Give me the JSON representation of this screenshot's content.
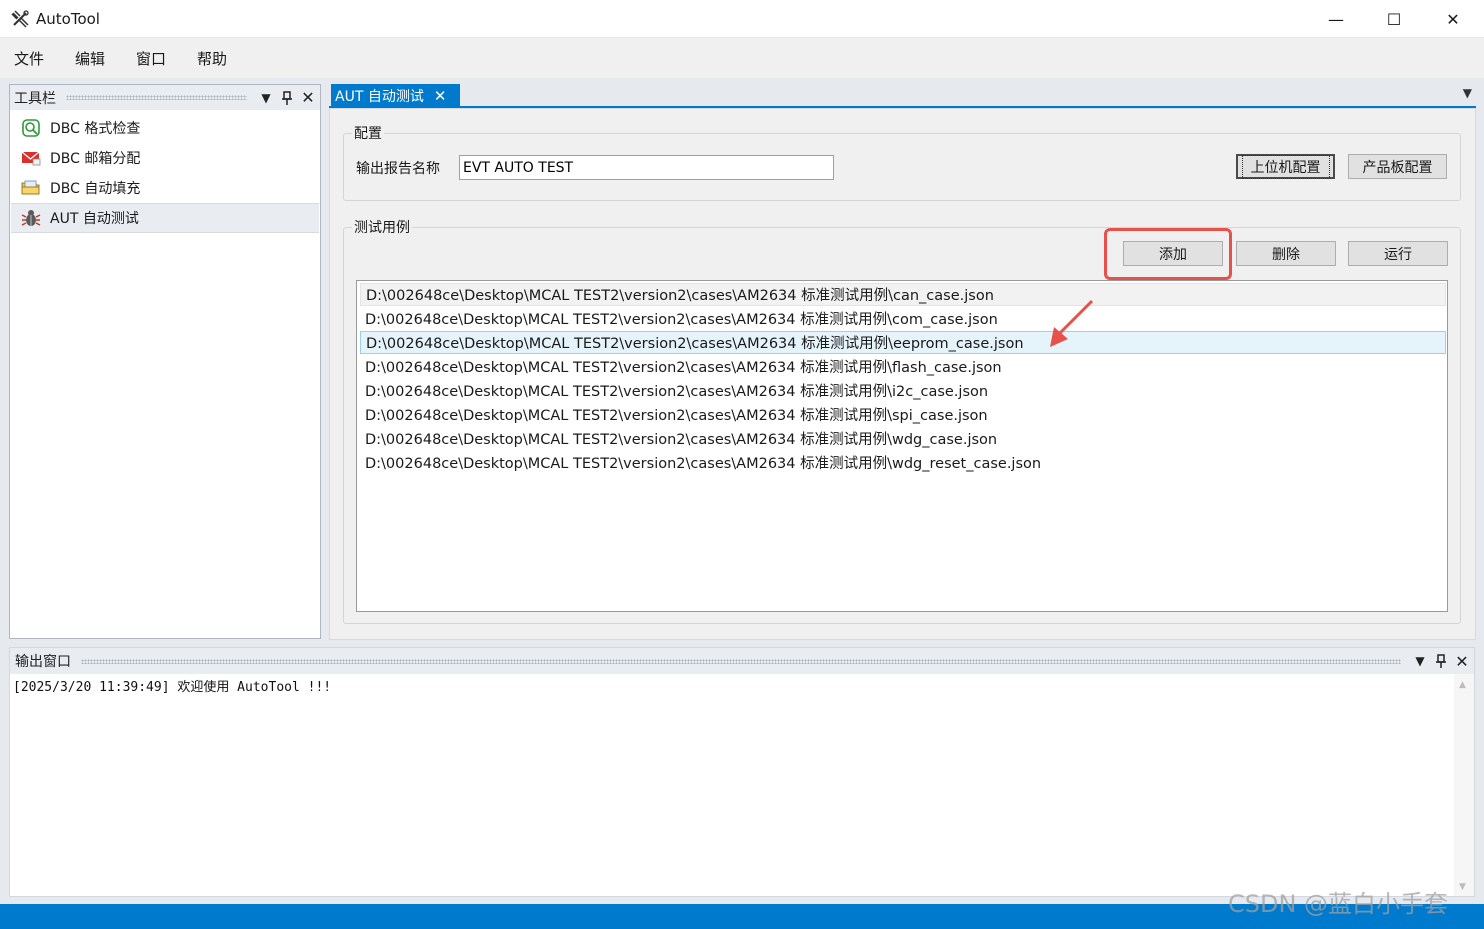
{
  "window": {
    "title": "AutoTool",
    "minimize_glyph": "—",
    "maximize_glyph": "☐",
    "close_glyph": "✕"
  },
  "menu": [
    "文件",
    "编辑",
    "窗口",
    "帮助"
  ],
  "toolbar_panel": {
    "title": "工具栏",
    "items": [
      {
        "label": "DBC 格式检查",
        "icon": "dbc-check-icon",
        "selected": false
      },
      {
        "label": "DBC 邮箱分配",
        "icon": "dbc-mailbox-icon",
        "selected": false
      },
      {
        "label": "DBC 自动填充",
        "icon": "dbc-autofill-icon",
        "selected": false
      },
      {
        "label": "AUT 自动测试",
        "icon": "bug-icon",
        "selected": true
      }
    ]
  },
  "document": {
    "tab_label": "AUT 自动测试",
    "config": {
      "group_label": "配置",
      "report_name_label": "输出报告名称",
      "report_name_value": "EVT AUTO TEST",
      "host_config_button": "上位机配置",
      "board_config_button": "产品板配置"
    },
    "test_cases": {
      "group_label": "测试用例",
      "add_button": "添加",
      "delete_button": "删除",
      "run_button": "运行",
      "items": [
        "D:\\002648ce\\Desktop\\MCAL TEST2\\version2\\cases\\AM2634 标准测试用例\\can_case.json",
        "D:\\002648ce\\Desktop\\MCAL TEST2\\version2\\cases\\AM2634 标准测试用例\\com_case.json",
        "D:\\002648ce\\Desktop\\MCAL TEST2\\version2\\cases\\AM2634 标准测试用例\\eeprom_case.json",
        "D:\\002648ce\\Desktop\\MCAL TEST2\\version2\\cases\\AM2634 标准测试用例\\flash_case.json",
        "D:\\002648ce\\Desktop\\MCAL TEST2\\version2\\cases\\AM2634 标准测试用例\\i2c_case.json",
        "D:\\002648ce\\Desktop\\MCAL TEST2\\version2\\cases\\AM2634 标准测试用例\\spi_case.json",
        "D:\\002648ce\\Desktop\\MCAL TEST2\\version2\\cases\\AM2634 标准测试用例\\wdg_case.json",
        "D:\\002648ce\\Desktop\\MCAL TEST2\\version2\\cases\\AM2634 标准测试用例\\wdg_reset_case.json"
      ],
      "selected_index": 2
    }
  },
  "output_panel": {
    "title": "输出窗口",
    "log": "[2025/3/20 11:39:49] 欢迎使用 AutoTool !!!"
  },
  "watermark": "CSDN @蓝白小手套",
  "colors": {
    "accent": "#007acc",
    "annotation_red": "#e8504a",
    "selection_bg": "#e5f3fb"
  }
}
